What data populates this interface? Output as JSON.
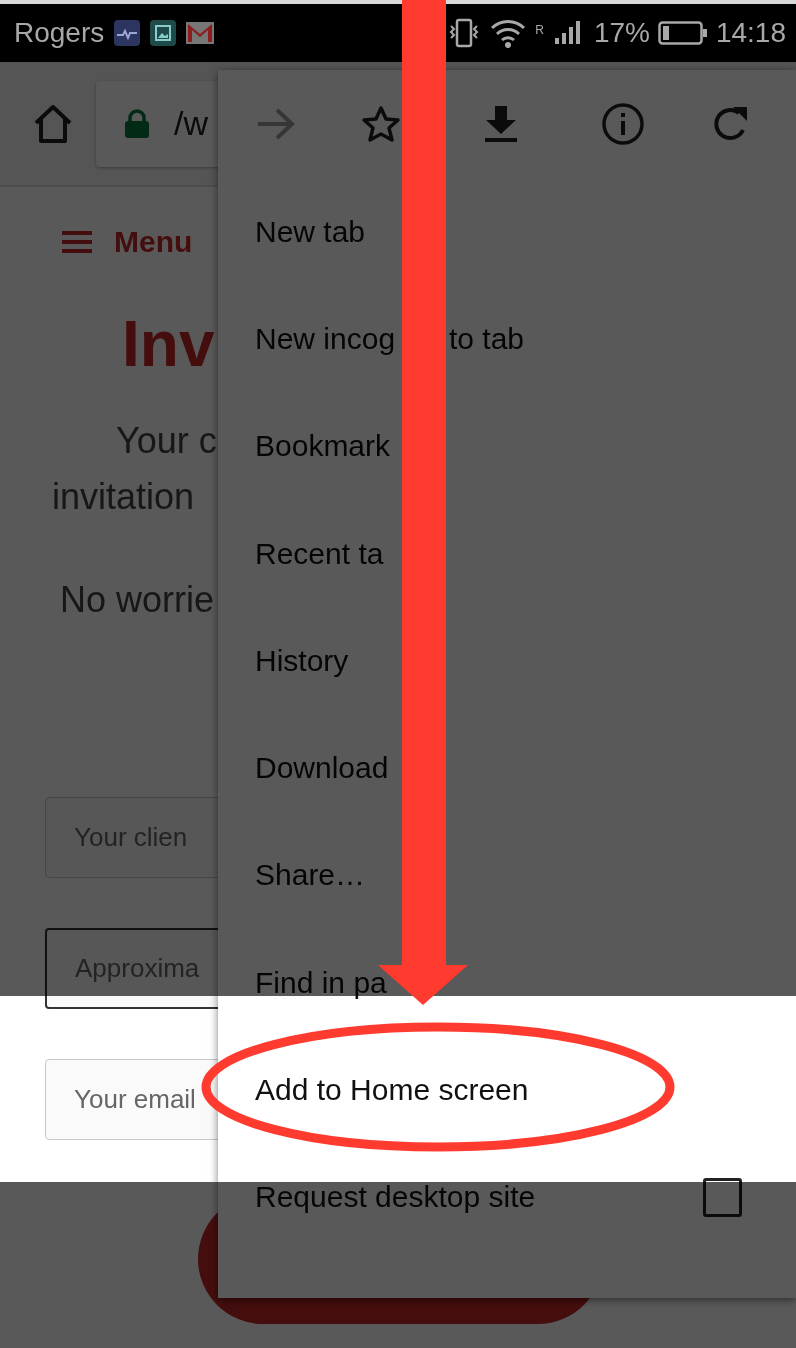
{
  "status_bar": {
    "carrier": "Rogers",
    "roaming": "R",
    "battery": "17%",
    "time": "14:18"
  },
  "browser": {
    "url": "/w"
  },
  "page": {
    "menu_label": "Menu",
    "heading": "Inv",
    "paragraph_lines": [
      "Your c",
      "invitation"
    ],
    "note": "No worrie",
    "fields": [
      {
        "placeholder": "Your clien",
        "focused": false
      },
      {
        "placeholder": "Approxima",
        "focused": true
      },
      {
        "placeholder": "Your email",
        "focused": false
      }
    ]
  },
  "overflow_menu": {
    "toolbar": [
      {
        "disabled": true
      },
      {
        "disabled": false
      },
      {
        "disabled": false
      },
      {
        "disabled": false
      },
      {
        "disabled": false
      }
    ],
    "items": [
      {
        "kind": "plain",
        "label": "New tab",
        "highlighted": false
      },
      {
        "kind": "plain",
        "label": "New incog",
        "label_after": "to tab",
        "highlighted": false
      },
      {
        "kind": "plain",
        "label": "Bookmark",
        "highlighted": false
      },
      {
        "kind": "plain",
        "label": "Recent ta",
        "highlighted": false
      },
      {
        "kind": "plain",
        "label": "History",
        "highlighted": false
      },
      {
        "kind": "plain",
        "label": "Download",
        "highlighted": false
      },
      {
        "kind": "plain",
        "label": "Share…",
        "highlighted": false
      },
      {
        "kind": "plain",
        "label": "Find in pa",
        "highlighted": false
      },
      {
        "kind": "plain",
        "label": "Add to Home screen",
        "highlighted": true
      },
      {
        "kind": "checkbox",
        "label": "Request desktop site",
        "checked": false,
        "highlighted": false
      }
    ]
  }
}
